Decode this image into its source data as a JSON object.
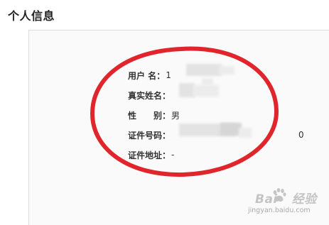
{
  "section": {
    "title": "个人信息"
  },
  "profile": {
    "fields": [
      {
        "label": "用户 名：",
        "value": "1"
      },
      {
        "label": "真实姓名：",
        "value": ""
      },
      {
        "label": "性　　别：",
        "value": "男"
      },
      {
        "label": "证件号码：",
        "value": "0"
      },
      {
        "label": "证件地址：",
        "value": "-"
      }
    ]
  },
  "watermark": {
    "brand_left": "Bai",
    "brand_right": "经验",
    "site": "jingyan.baidu.com"
  },
  "colors": {
    "annotation_circle": "#e0262c",
    "card_background": "#fafafa",
    "card_border": "#dcdcdc",
    "watermark": "#c4c4c4"
  }
}
